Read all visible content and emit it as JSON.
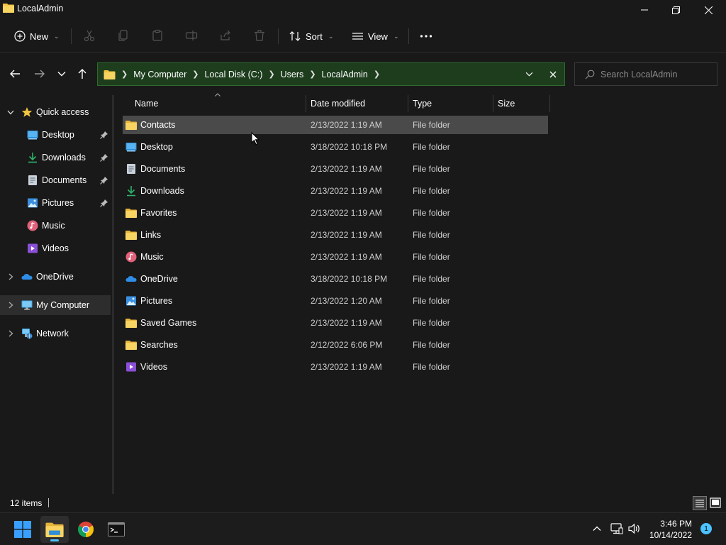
{
  "window": {
    "title": "LocalAdmin"
  },
  "commandbar": {
    "new_label": "New",
    "sort_label": "Sort",
    "view_label": "View"
  },
  "address": {
    "breadcrumbs": [
      "My Computer",
      "Local Disk (C:)",
      "Users",
      "LocalAdmin"
    ]
  },
  "search": {
    "placeholder": "Search LocalAdmin"
  },
  "sidebar": {
    "quick_access": "Quick access",
    "quick_items": [
      {
        "label": "Desktop",
        "icon": "desktop-icon",
        "pinned": true
      },
      {
        "label": "Downloads",
        "icon": "downloads-icon",
        "pinned": true
      },
      {
        "label": "Documents",
        "icon": "documents-icon",
        "pinned": true
      },
      {
        "label": "Pictures",
        "icon": "pictures-icon",
        "pinned": true
      },
      {
        "label": "Music",
        "icon": "music-icon",
        "pinned": false
      },
      {
        "label": "Videos",
        "icon": "videos-icon",
        "pinned": false
      }
    ],
    "onedrive": "OneDrive",
    "my_computer": "My Computer",
    "network": "Network"
  },
  "columns": {
    "name": "Name",
    "date": "Date modified",
    "type": "Type",
    "size": "Size"
  },
  "files": [
    {
      "name": "Contacts",
      "date": "2/13/2022 1:19 AM",
      "type": "File folder",
      "icon": "folder-icon"
    },
    {
      "name": "Desktop",
      "date": "3/18/2022 10:18 PM",
      "type": "File folder",
      "icon": "desktop-icon"
    },
    {
      "name": "Documents",
      "date": "2/13/2022 1:19 AM",
      "type": "File folder",
      "icon": "documents-icon"
    },
    {
      "name": "Downloads",
      "date": "2/13/2022 1:19 AM",
      "type": "File folder",
      "icon": "downloads-icon"
    },
    {
      "name": "Favorites",
      "date": "2/13/2022 1:19 AM",
      "type": "File folder",
      "icon": "folder-icon"
    },
    {
      "name": "Links",
      "date": "2/13/2022 1:19 AM",
      "type": "File folder",
      "icon": "folder-icon"
    },
    {
      "name": "Music",
      "date": "2/13/2022 1:19 AM",
      "type": "File folder",
      "icon": "music-icon"
    },
    {
      "name": "OneDrive",
      "date": "3/18/2022 10:18 PM",
      "type": "File folder",
      "icon": "onedrive-icon"
    },
    {
      "name": "Pictures",
      "date": "2/13/2022 1:20 AM",
      "type": "File folder",
      "icon": "pictures-icon"
    },
    {
      "name": "Saved Games",
      "date": "2/13/2022 1:19 AM",
      "type": "File folder",
      "icon": "folder-icon"
    },
    {
      "name": "Searches",
      "date": "2/12/2022 6:06 PM",
      "type": "File folder",
      "icon": "folder-icon"
    },
    {
      "name": "Videos",
      "date": "2/13/2022 1:19 AM",
      "type": "File folder",
      "icon": "videos-icon"
    }
  ],
  "status": {
    "item_count": "12 items"
  },
  "taskbar": {
    "time": "3:46 PM",
    "date": "10/14/2022",
    "notification_count": "1"
  },
  "colors": {
    "background": "#191919",
    "address_bar": "#1d3d1d",
    "selected_row": "#4a4a4a",
    "folder_yellow": "#f3c442",
    "accent": "#4cc2ff"
  }
}
